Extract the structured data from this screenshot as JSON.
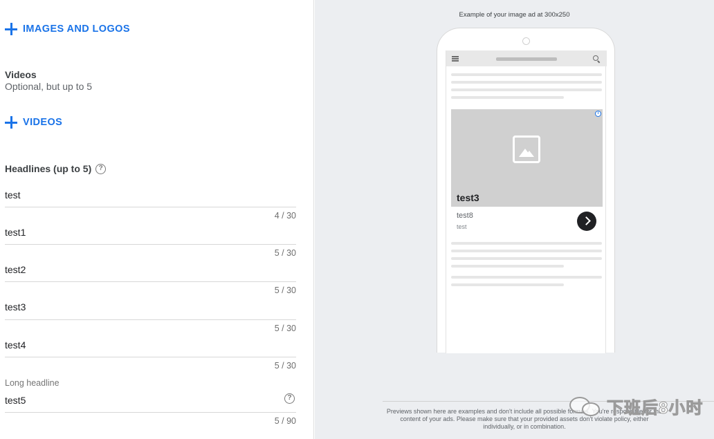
{
  "form": {
    "images_button_label": "IMAGES AND LOGOS",
    "videos_title": "Videos",
    "videos_subtitle": "Optional, but up to 5",
    "videos_button_label": "VIDEOS",
    "headlines_title": "Headlines (up to 5)",
    "help_glyph": "?",
    "headlines": [
      {
        "value": "test",
        "count": "4 / 30"
      },
      {
        "value": "test1",
        "count": "5 / 30"
      },
      {
        "value": "test2",
        "count": "5 / 30"
      },
      {
        "value": "test3",
        "count": "5 / 30"
      },
      {
        "value": "test4",
        "count": "5 / 30"
      }
    ],
    "long_headline": {
      "label": "Long headline",
      "value": "test5",
      "count": "5 / 90"
    }
  },
  "preview": {
    "caption": "Example of your image ad at 300x250",
    "adchoices_glyph": "i",
    "ad": {
      "headline": "test3",
      "description": "test8",
      "business": "test"
    },
    "disclaimer": "Previews shown here are examples and don't include all possible formats. You're responsible for the content of your ads. Please make sure that your provided assets don't violate policy, either individually, or in combination."
  },
  "watermark": {
    "text": "下班后8小时"
  },
  "colors": {
    "accent": "#1a73e8",
    "panel_bg": "#eceef1",
    "ad_image_bg": "#d0d0d0"
  },
  "icons": [
    "plus-icon",
    "help-icon",
    "menu-icon",
    "search-icon",
    "image-placeholder-icon",
    "adchoices-icon",
    "chevron-right-icon",
    "wechat-icon"
  ]
}
